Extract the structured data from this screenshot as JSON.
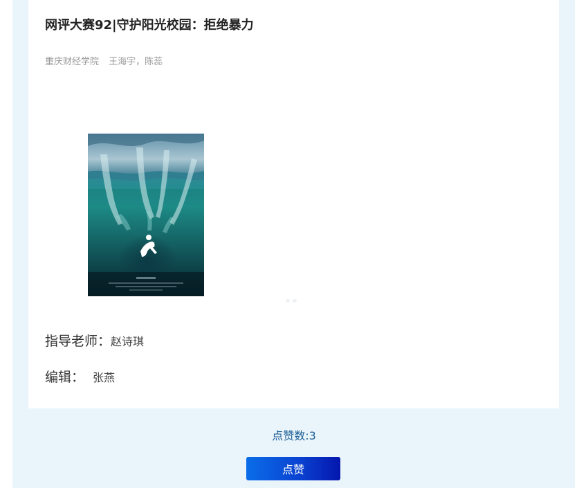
{
  "article": {
    "title": "网评大赛92|守护阳光校园：拒绝暴力",
    "school": "重庆财经学院",
    "authors": "王海宇，陈蕊",
    "advisor_label": "指导老师：",
    "advisor_name": "赵诗琪",
    "editor_label": "编辑：",
    "editor_name": "张燕"
  },
  "likes": {
    "count_text": "点赞数:3",
    "button_label": "点赞"
  },
  "colors": {
    "page_background": "#eaf5fb",
    "likes_text": "#1d5e96",
    "button_gradient_start": "#0a6de8",
    "button_gradient_end": "#0416ad"
  }
}
